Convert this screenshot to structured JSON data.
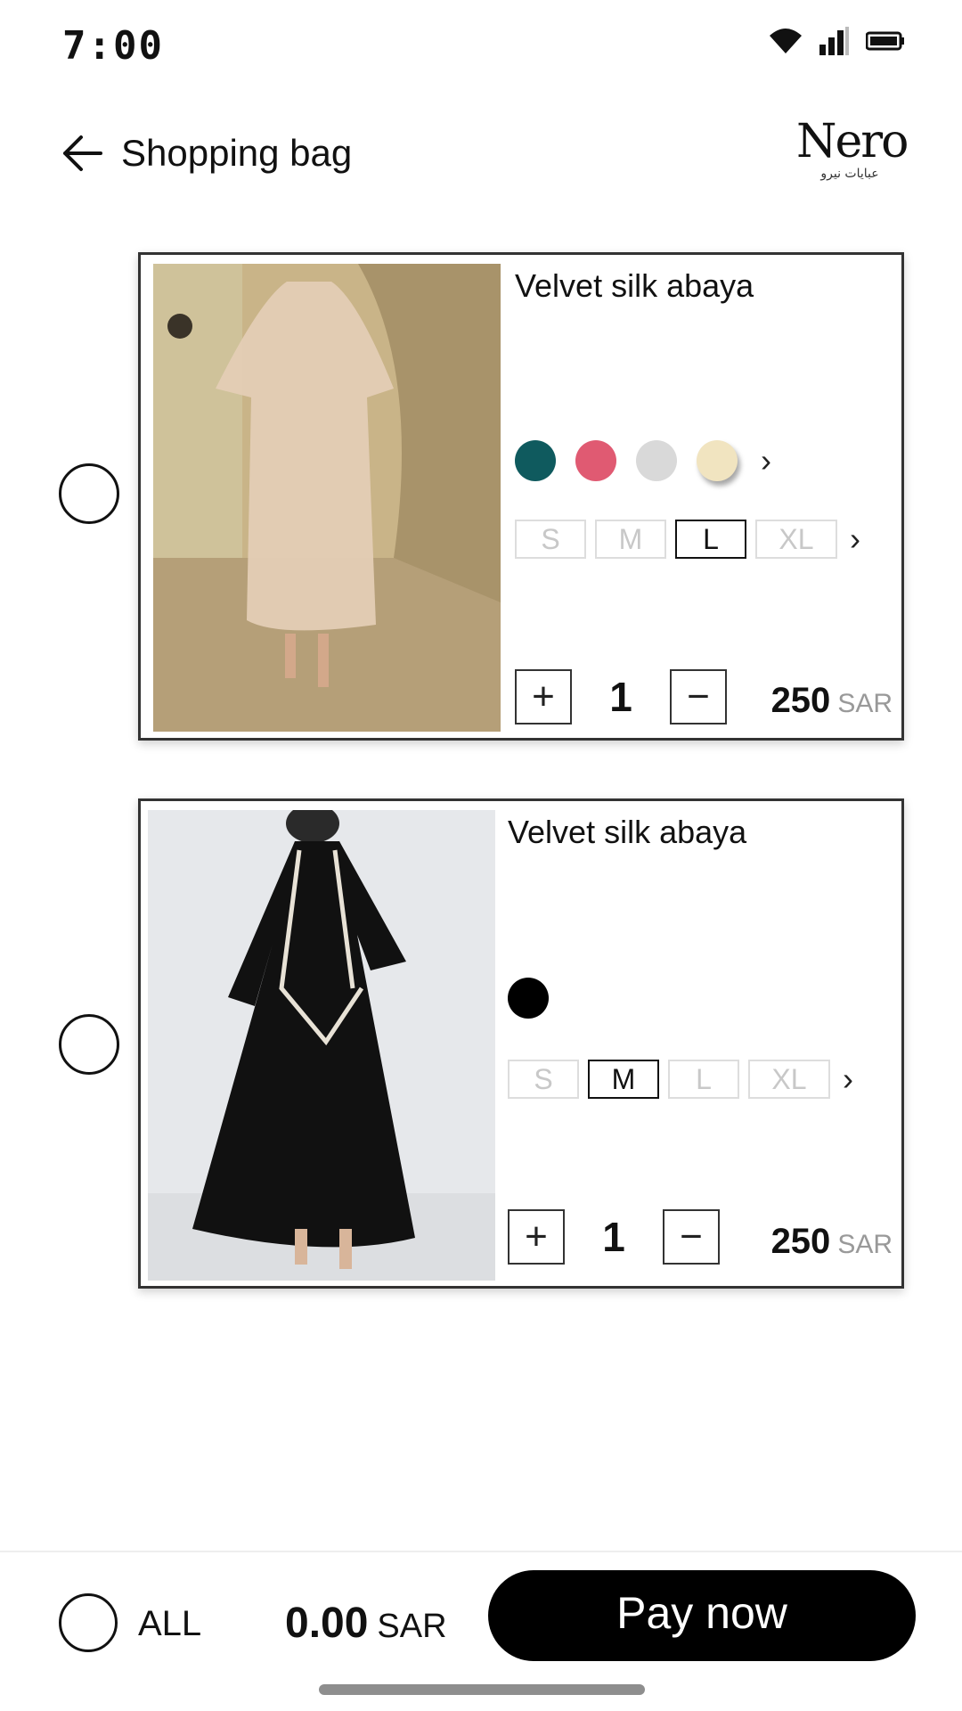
{
  "status_bar": {
    "time": "7:00"
  },
  "header": {
    "title": "Shopping bag",
    "brand": {
      "name": "Nero",
      "subtitle": "عبايات نيرو"
    }
  },
  "cart": {
    "items": [
      {
        "name": "Velvet silk abaya",
        "colors": [
          "#0f5a5e",
          "#e05a72",
          "#d9d9d9",
          "#f1e4c0"
        ],
        "selected_color": "#f1e4c0",
        "sizes": [
          "S",
          "M",
          "L",
          "XL"
        ],
        "selected_size": "L",
        "quantity": "1",
        "price": "250",
        "currency": "SAR"
      },
      {
        "name": "Velvet silk abaya",
        "colors": [
          "#000000"
        ],
        "sizes": [
          "S",
          "M",
          "L",
          "XL"
        ],
        "selected_size": "M",
        "quantity": "1",
        "price": "250",
        "currency": "SAR"
      }
    ]
  },
  "footer": {
    "select_all_label": "ALL",
    "total": "0.00",
    "currency": "SAR",
    "pay_label": "Pay now"
  }
}
